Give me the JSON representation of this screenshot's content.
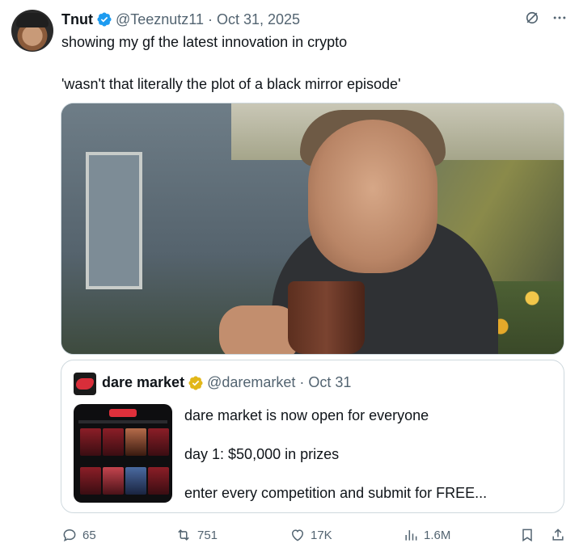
{
  "author": {
    "name": "Tnut",
    "handle": "@Teeznutz11",
    "separator": "·",
    "date": "Oct 31, 2025"
  },
  "tweet": {
    "line1": "showing my gf the latest innovation in crypto",
    "line2": "'wasn't that literally the plot of a black mirror episode'"
  },
  "quote": {
    "name": "dare market",
    "handle": "@daremarket",
    "separator": "·",
    "date": "Oct 31",
    "lines": [
      "dare market is now open for everyone",
      "day 1: $50,000 in prizes",
      "enter every competition and submit for FREE..."
    ]
  },
  "stats": {
    "replies": "65",
    "reposts": "751",
    "likes": "17K",
    "views": "1.6M"
  },
  "colors": {
    "verified_blue": "#1d9bf0",
    "verified_gold": "#e2b719",
    "secondary_text": "#536471",
    "border": "#cfd9de"
  },
  "icons": [
    "grok-icon",
    "more-icon",
    "reply-icon",
    "repost-icon",
    "like-icon",
    "views-icon",
    "bookmark-icon",
    "share-icon"
  ]
}
